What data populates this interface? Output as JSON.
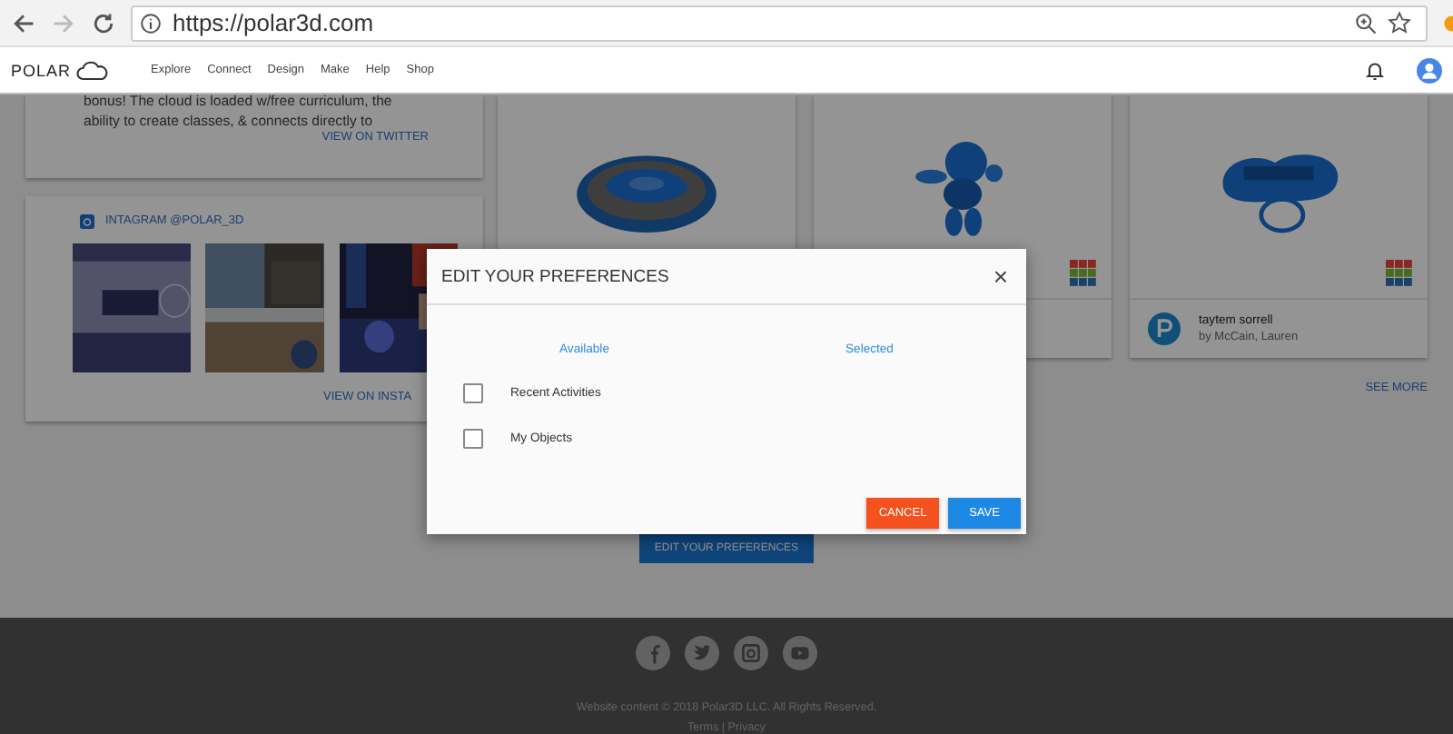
{
  "browser": {
    "url": "https://polar3d.com"
  },
  "nav": {
    "logo": "POLAR",
    "items": [
      "Explore",
      "Connect",
      "Design",
      "Make",
      "Help",
      "Shop"
    ]
  },
  "twitter": {
    "text": "bonus! The cloud is loaded w/free curriculum, the ability to create classes, & connects directly to",
    "link": "VIEW ON TWITTER"
  },
  "instagram": {
    "title": "INTAGRAM @POLAR_3D",
    "link": "VIEW ON INSTA"
  },
  "cards": [
    {
      "kind": "ring"
    },
    {
      "kind": "figure",
      "tinkercad": true
    },
    {
      "kind": "keychain",
      "tinkercad": true,
      "title": "taytem sorrell",
      "author": "by McCain, Lauren"
    }
  ],
  "see_more": "SEE MORE",
  "preferences_button": "EDIT YOUR PREFERENCES",
  "modal": {
    "title": "EDIT YOUR PREFERENCES",
    "close": "×",
    "columns": [
      "Available",
      "Selected"
    ],
    "items": [
      {
        "label": "Recent Activities",
        "checked": false
      },
      {
        "label": "My Objects",
        "checked": false
      }
    ],
    "buttons": [
      {
        "kind": "cancel",
        "label": "CANCEL"
      },
      {
        "kind": "save",
        "label": "SAVE"
      }
    ]
  },
  "footer": {
    "copyright": "Website content © 2018 Polar3D LLC. All Rights Reserved.",
    "links": "Terms | Privacy"
  }
}
